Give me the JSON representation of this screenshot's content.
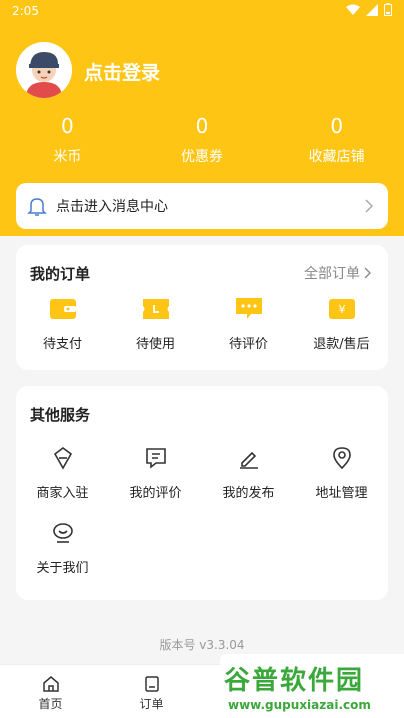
{
  "status": {
    "time": "2:05"
  },
  "profile": {
    "login_label": "点击登录"
  },
  "stats": [
    {
      "value": "0",
      "label": "米币"
    },
    {
      "value": "0",
      "label": "优惠券"
    },
    {
      "value": "0",
      "label": "收藏店铺"
    }
  ],
  "message": {
    "label": "点击进入消息中心"
  },
  "orders": {
    "title": "我的订单",
    "all_label": "全部订单",
    "items": [
      {
        "label": "待支付",
        "icon": "wallet-icon"
      },
      {
        "label": "待使用",
        "icon": "ticket-icon"
      },
      {
        "label": "待评价",
        "icon": "comment-icon"
      },
      {
        "label": "退款/售后",
        "icon": "refund-icon"
      }
    ]
  },
  "services": {
    "title": "其他服务",
    "items": [
      {
        "label": "商家入驻",
        "icon": "merchant-icon"
      },
      {
        "label": "我的评价",
        "icon": "review-icon"
      },
      {
        "label": "我的发布",
        "icon": "edit-icon"
      },
      {
        "label": "地址管理",
        "icon": "location-icon"
      },
      {
        "label": "关于我们",
        "icon": "about-icon"
      }
    ]
  },
  "version": "版本号 v3.3.04",
  "tabs": [
    {
      "label": "首页",
      "icon": "home-icon"
    },
    {
      "label": "订单",
      "icon": "order-icon"
    },
    {
      "label": "",
      "icon": ""
    },
    {
      "label": "",
      "icon": ""
    }
  ],
  "watermark": {
    "main": "谷普软件园",
    "url": "www.gupuxiazai.com"
  },
  "colors": {
    "accent": "#ffc515",
    "background": "#f5f5f5"
  }
}
